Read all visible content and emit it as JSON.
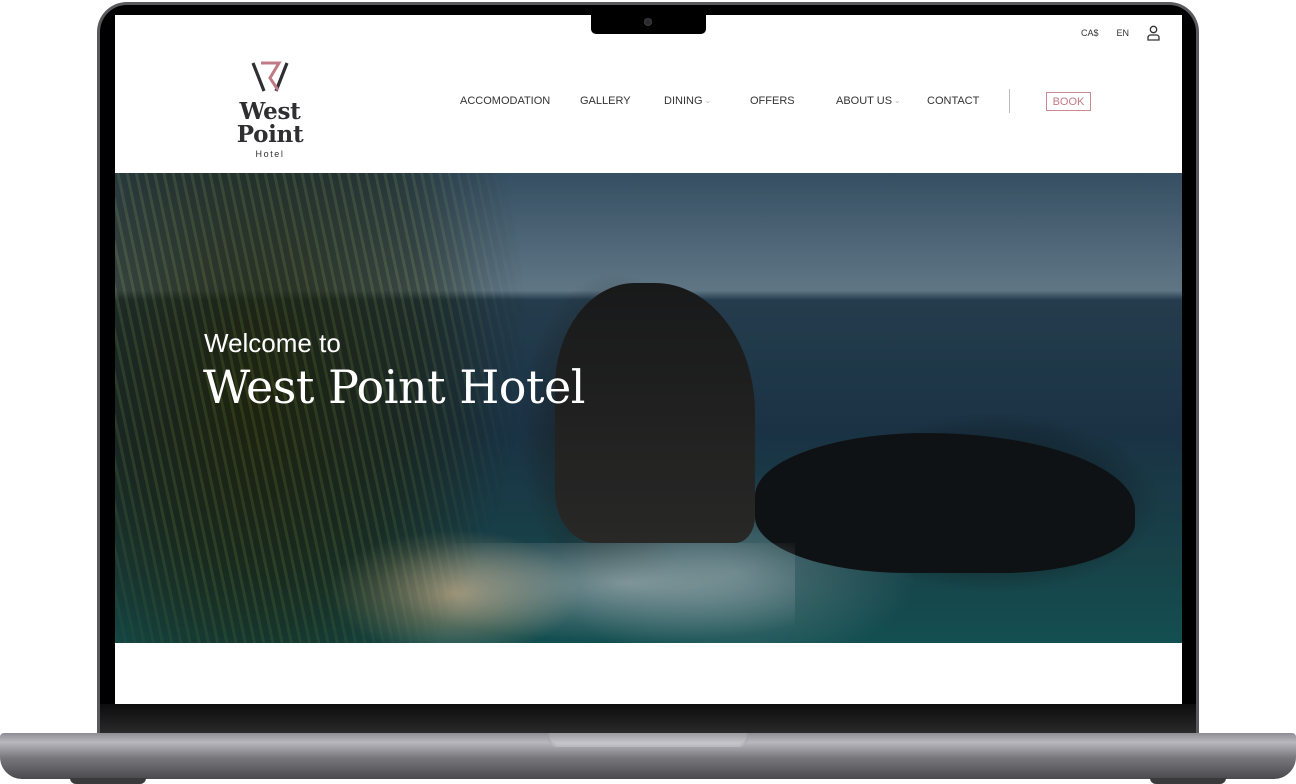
{
  "site": {
    "brand": {
      "name": "West Point",
      "subtitle": "Hotel",
      "accent_color": "#c07a84",
      "text_color": "#2f2f31"
    },
    "utility_bar": {
      "currency": "CA$",
      "language": "EN",
      "account_icon": "user-icon"
    },
    "nav": {
      "items": [
        {
          "label": "ACCOMODATION",
          "has_dropdown": false
        },
        {
          "label": "GALLERY",
          "has_dropdown": false
        },
        {
          "label": "DINING",
          "has_dropdown": true
        },
        {
          "label": "OFFERS",
          "has_dropdown": false
        },
        {
          "label": "ABOUT US",
          "has_dropdown": true
        },
        {
          "label": "CONTACT",
          "has_dropdown": false
        }
      ],
      "dropdown_icon": "⌄",
      "book_label": "BOOK"
    },
    "hero": {
      "welcome": "Welcome to",
      "title": "West Point Hotel",
      "image_description": "palm fronds over a coastal cliff with beach, sea rocks and ocean"
    }
  },
  "device": {
    "frame": "laptop"
  }
}
